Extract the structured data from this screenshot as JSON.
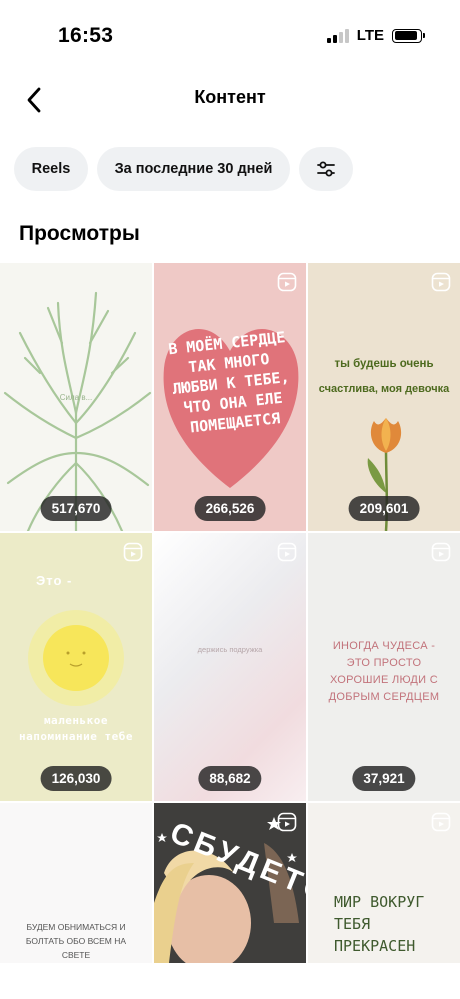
{
  "status_bar": {
    "time": "16:53",
    "network": "LTE"
  },
  "header": {
    "title": "Контент"
  },
  "filters": {
    "type": "Reels",
    "period": "За последние 30 дней"
  },
  "section": {
    "title": "Просмотры"
  },
  "tiles": [
    {
      "views": "517,670",
      "cover_text": "Сила в..."
    },
    {
      "views": "266,526",
      "cover_text": "В моём сердце так много любви к тебе, что она еле помещается"
    },
    {
      "views": "209,601",
      "cover_text_1": "ты будешь очень",
      "cover_text_2": "счастлива, моя девочка"
    },
    {
      "views": "126,030",
      "cover_text_1": "Это -",
      "cover_text_2": "маленькое напоминание тебе"
    },
    {
      "views": "88,682",
      "cover_text": "держись подружка"
    },
    {
      "views": "37,921",
      "cover_text": "иногда чудеса - это просто хорошие люди с добрым сердцем"
    },
    {
      "views": "",
      "cover_text": "будем обниматься и болтать обо всем на свете"
    },
    {
      "views": "",
      "cover_text": "Сбудется"
    },
    {
      "views": "",
      "cover_text": "Мир вокруг тебя прекрасен"
    }
  ],
  "colors": {
    "chip_bg": "#eff1f3",
    "badge_bg": "#232323",
    "heart": "#e0737a"
  },
  "icons": [
    "back-arrow-icon",
    "sliders-icon",
    "reel-icon"
  ]
}
